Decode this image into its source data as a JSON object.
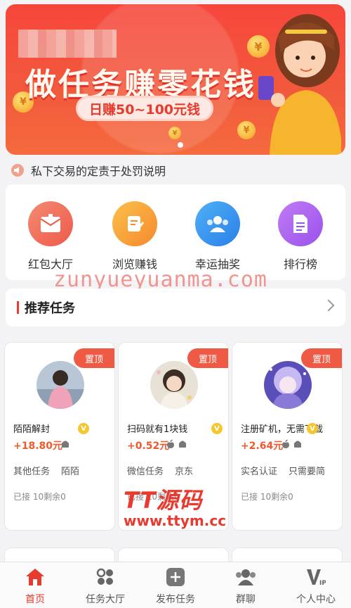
{
  "banner": {
    "headline": "做任务赚零花钱",
    "pill": "日赚50~100元钱",
    "coin_symbol": "¥"
  },
  "notice": {
    "text": "私下交易的定责于处罚说明"
  },
  "quick_nav": [
    {
      "label": "红包大厅",
      "icon": "red-envelope-icon",
      "color": "#f0715a"
    },
    {
      "label": "浏览赚钱",
      "icon": "notepad-icon",
      "color": "#f7a33a"
    },
    {
      "label": "幸运抽奖",
      "icon": "users-icon",
      "color": "#2b8ff0"
    },
    {
      "label": "排行榜",
      "icon": "document-icon",
      "color": "#a25df0"
    }
  ],
  "watermark": "zunyueyuanma.com",
  "section": {
    "title": "推荐任务"
  },
  "tasks": [
    {
      "badge": "置顶",
      "name": "陌陌解封",
      "price": "+18.80元",
      "tag1": "其他任务",
      "tag2": "陌陌",
      "stat": "已接 10剩余0"
    },
    {
      "badge": "置顶",
      "name": "扫码就有1块钱",
      "price": "+0.52元",
      "tag1": "微信任务",
      "tag2": "京东",
      "stat": "已接 10剩余0"
    },
    {
      "badge": "置顶",
      "name": "注册矿机，无需下载",
      "price": "+2.64元",
      "tag1": "实名认证",
      "tag2": "只需要简",
      "stat": "已接 10剩余0"
    }
  ],
  "ttym_watermark": {
    "big": "TT源码",
    "url": "www.ttym.cc"
  },
  "tabbar": [
    {
      "label": "首页",
      "icon": "home-icon",
      "active": true
    },
    {
      "label": "任务大厅",
      "icon": "grid-icon",
      "active": false
    },
    {
      "label": "发布任务",
      "icon": "plus-icon",
      "active": false
    },
    {
      "label": "群聊",
      "icon": "group-chat-icon",
      "active": false
    },
    {
      "label": "个人中心",
      "icon": "vip-icon",
      "active": false
    }
  ],
  "colors": {
    "accent": "#e83a2e",
    "price": "#ef5a2d"
  }
}
